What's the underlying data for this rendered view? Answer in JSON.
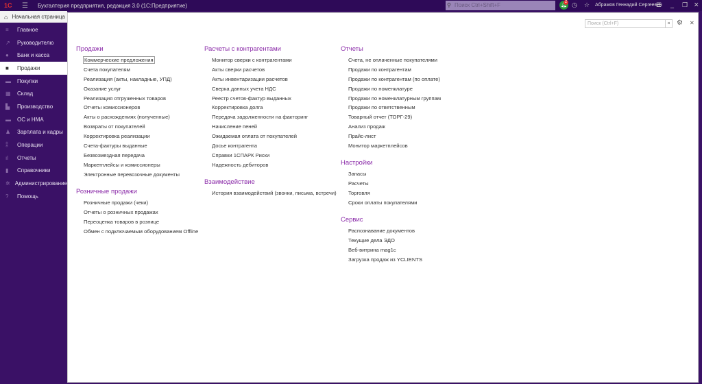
{
  "titlebar": {
    "logo": "1С",
    "title": "Бухгалтерия предприятия, редакция 3.0  (1С:Предприятие)",
    "search_placeholder": "Поиск Ctrl+Shift+F",
    "notifications": "2",
    "user": "Абрамов Геннадий Сергеевич"
  },
  "tab": {
    "home": "Начальная страница"
  },
  "sidebar": {
    "items": [
      {
        "label": "Главное",
        "icon": "≡"
      },
      {
        "label": "Руководителю",
        "icon": "↗"
      },
      {
        "label": "Банк и касса",
        "icon": "●"
      },
      {
        "label": "Продажи",
        "icon": "■"
      },
      {
        "label": "Покупки",
        "icon": "▬"
      },
      {
        "label": "Склад",
        "icon": "▦"
      },
      {
        "label": "Производство",
        "icon": "▙"
      },
      {
        "label": "ОС и НМА",
        "icon": "▬"
      },
      {
        "label": "Зарплата и кадры",
        "icon": "♟"
      },
      {
        "label": "Операции",
        "icon": "⁑"
      },
      {
        "label": "Отчеты",
        "icon": "ıl"
      },
      {
        "label": "Справочники",
        "icon": "▮"
      },
      {
        "label": "Администрирование",
        "icon": "✲"
      },
      {
        "label": "Помощь",
        "icon": "?"
      }
    ],
    "active": "Продажи"
  },
  "panel": {
    "search_placeholder": "Поиск (Ctrl+F)"
  },
  "sections": [
    {
      "title": "Продажи",
      "items": [
        "Коммерческие предложения",
        "Счета покупателям",
        "Реализация (акты, накладные, УПД)",
        "Оказание услуг",
        "Реализация отгруженных товаров",
        "Отчеты комиссионеров",
        "Акты о расхождениях (полученные)",
        "Возвраты от покупателей",
        "Корректировка реализации",
        "Счета-фактуры выданные",
        "Безвозмездная передача",
        "Маркетплейсы и комиссионеры",
        "Электронные перевозочные документы"
      ]
    },
    {
      "title": "Розничные продажи",
      "items": [
        "Розничные продажи (чеки)",
        "Отчеты о розничных продажах",
        "Переоценка товаров в рознице",
        "Обмен с подключаемым оборудованием Offline"
      ]
    },
    {
      "title": "Расчеты с контрагентами",
      "items": [
        "Монитор сверки с контрагентами",
        "Акты сверки расчетов",
        "Акты инвентаризации расчетов",
        "Сверка данных учета НДС",
        "Реестр счетов-фактур выданных",
        "Корректировка долга",
        "Передача задолженности на факторинг",
        "Начисление пеней",
        "Ожидаемая оплата от покупателей",
        "Досье контрагента",
        "Справки 1СПАРК Риски",
        "Надежность дебиторов"
      ]
    },
    {
      "title": "Взаимодействие",
      "items": [
        "История взаимодействий (звонки, письма, встречи)"
      ]
    },
    {
      "title": "Отчеты",
      "items": [
        "Счета, не оплаченные покупателями",
        "Продажи по контрагентам",
        "Продажи по контрагентам (по оплате)",
        "Продажи по номенклатуре",
        "Продажи по номенклатурным группам",
        "Продажи по ответственным",
        "Товарный отчет (ТОРГ-29)",
        "Анализ продаж",
        "Прайс-лист",
        "Монитор маркетплейсов"
      ]
    },
    {
      "title": "Настройки",
      "items": [
        "Запасы",
        "Расчеты",
        "Торговля",
        "Сроки оплаты покупателями"
      ]
    },
    {
      "title": "Сервис",
      "items": [
        "Распознавание документов",
        "Текущие дела ЭДО",
        "Веб-витрина mag1c",
        "Загрузка продаж из YCLIENTS"
      ]
    }
  ]
}
